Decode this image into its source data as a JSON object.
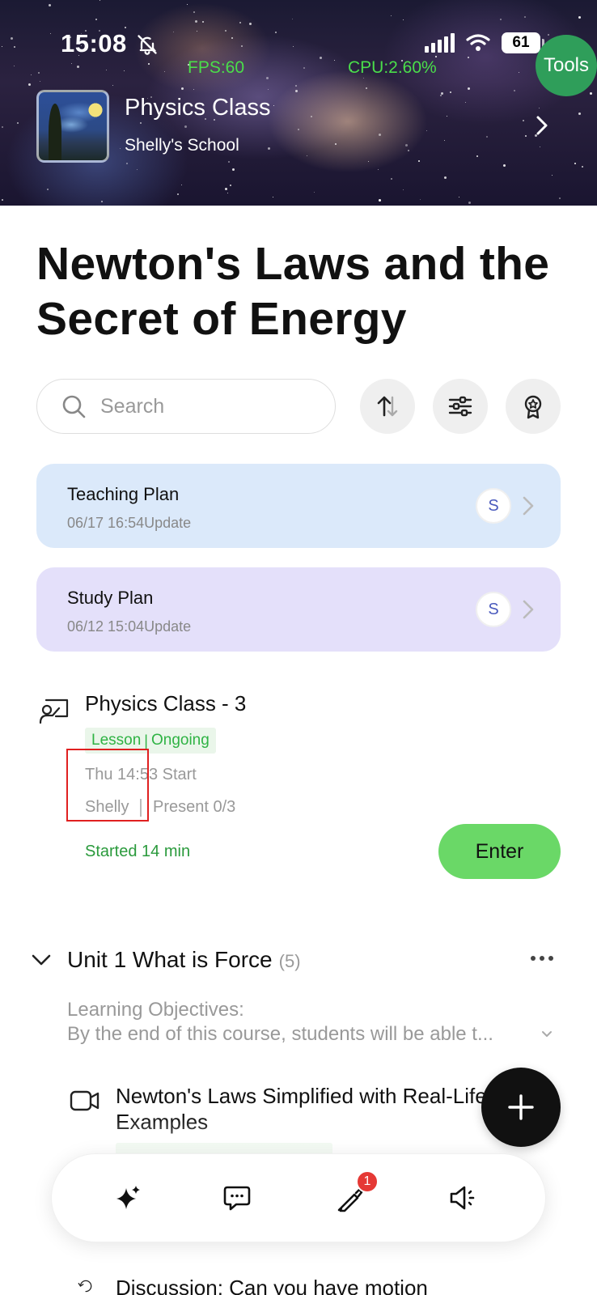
{
  "status_bar": {
    "time": "15:08",
    "battery": "61",
    "fps": "FPS:60",
    "cpu": "CPU:2.60%"
  },
  "tools_label": "Tools",
  "class_header": {
    "title": "Physics Class",
    "school": "Shelly's School"
  },
  "page_title": "Newton's Laws and the Secret of Energy",
  "search": {
    "placeholder": "Search"
  },
  "plans": [
    {
      "title": "Teaching Plan",
      "updated": "06/17 16:54Update",
      "avatar": "S"
    },
    {
      "title": "Study Plan",
      "updated": "06/12 15:04Update",
      "avatar": "S"
    }
  ],
  "session": {
    "title": "Physics Class - 3",
    "tag_type": "Lesson",
    "tag_status": "Ongoing",
    "start": "Thu 14:53 Start",
    "teacher": "Shelly",
    "present": "Present 0/3",
    "started": "Started 14 min",
    "enter_label": "Enter"
  },
  "unit": {
    "title": "Unit 1 What is Force",
    "count": "(5)",
    "objectives_label": "Learning Objectives:",
    "objectives_text": "By the end of this course, students will be able t..."
  },
  "lesson": {
    "title": "Newton's Laws Simplified with Real-Life Examples"
  },
  "next_item": {
    "title": "Discussion: Can you have motion"
  },
  "dock": {
    "badge_count": "1"
  },
  "colors": {
    "accent_green": "#6ad867",
    "tag_green": "#2fb344",
    "plan_blue": "#dbe9fa",
    "plan_purple": "#e4e0fa",
    "badge_red": "#e53935"
  }
}
